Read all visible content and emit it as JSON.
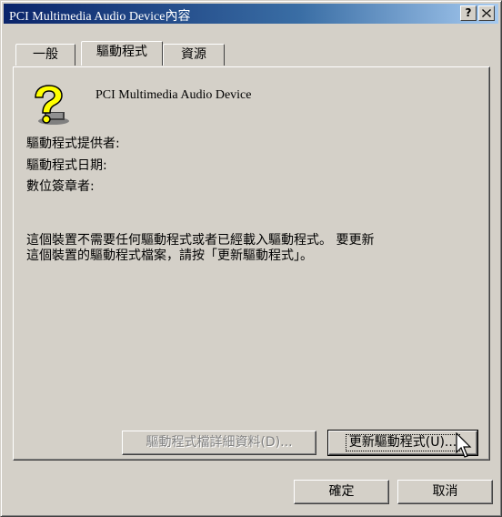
{
  "window": {
    "title": "PCI Multimedia Audio Device內容",
    "help_button": "?",
    "close_button": "✕"
  },
  "tabs": [
    {
      "label": "一般",
      "active": false
    },
    {
      "label": "驅動程式",
      "active": true
    },
    {
      "label": "資源",
      "active": false
    }
  ],
  "driver": {
    "device_name": "PCI Multimedia Audio Device",
    "provider_label": "驅動程式提供者:",
    "date_label": "驅動程式日期:",
    "signer_label": "數位簽章者:",
    "message_line1": "這個裝置不需要任何驅動程式或者已經載入驅動程式。 要更新",
    "message_line2": "這個裝置的驅動程式檔案，請按「更新驅動程式」。",
    "details_button": "驅動程式檔詳細資料(D)...",
    "update_button": "更新驅動程式(U)..."
  },
  "footer": {
    "ok_button": "確定",
    "cancel_button": "取消"
  },
  "colors": {
    "face": "#d4d0c8",
    "title_start": "#0a246a",
    "title_end": "#a6caf0",
    "disabled_text": "#808080"
  }
}
